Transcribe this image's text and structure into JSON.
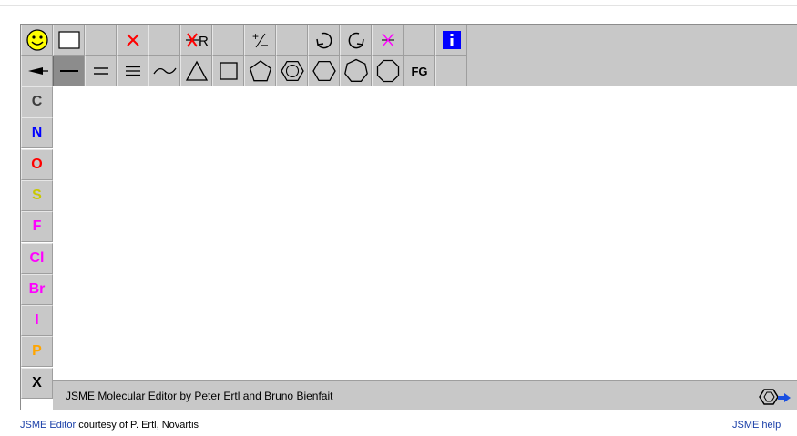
{
  "app": {
    "status_text": "JSME Molecular Editor by Peter Ertl and Bruno Bienfait"
  },
  "toolbar_top": [
    {
      "name": "smiley-icon",
      "kind": "icon"
    },
    {
      "name": "clear-icon",
      "kind": "icon"
    },
    {
      "name": "empty",
      "kind": "empty"
    },
    {
      "name": "delete-icon",
      "kind": "icon"
    },
    {
      "name": "empty",
      "kind": "empty"
    },
    {
      "name": "delete-r-icon",
      "kind": "icon"
    },
    {
      "name": "empty",
      "kind": "empty"
    },
    {
      "name": "charge-icon",
      "kind": "icon"
    },
    {
      "name": "empty",
      "kind": "empty"
    },
    {
      "name": "undo-icon",
      "kind": "icon"
    },
    {
      "name": "redo-icon",
      "kind": "icon"
    },
    {
      "name": "reaction-icon",
      "kind": "icon"
    },
    {
      "name": "empty",
      "kind": "empty"
    },
    {
      "name": "info-icon",
      "kind": "icon"
    }
  ],
  "toolbar_bottom": [
    {
      "name": "bond-stereo-icon",
      "kind": "icon"
    },
    {
      "name": "single-bond-icon",
      "kind": "icon",
      "selected": true
    },
    {
      "name": "double-bond-icon",
      "kind": "icon"
    },
    {
      "name": "triple-bond-icon",
      "kind": "icon"
    },
    {
      "name": "chain-icon",
      "kind": "icon"
    },
    {
      "name": "ring3-icon",
      "kind": "icon"
    },
    {
      "name": "ring4-icon",
      "kind": "icon"
    },
    {
      "name": "ring5-icon",
      "kind": "icon"
    },
    {
      "name": "benzene-icon",
      "kind": "icon"
    },
    {
      "name": "ring6-icon",
      "kind": "icon"
    },
    {
      "name": "ring7-icon",
      "kind": "icon"
    },
    {
      "name": "ring8-icon",
      "kind": "icon"
    },
    {
      "name": "fg-button",
      "kind": "text",
      "label": "FG"
    },
    {
      "name": "empty",
      "kind": "empty"
    }
  ],
  "atoms": [
    {
      "symbol": "C",
      "color": "#3c3c3c"
    },
    {
      "symbol": "N",
      "color": "#0000ff"
    },
    {
      "symbol": "O",
      "color": "#ff0000"
    },
    {
      "symbol": "S",
      "color": "#c8c800"
    },
    {
      "symbol": "F",
      "color": "#ff00ff"
    },
    {
      "symbol": "Cl",
      "color": "#ff00ff"
    },
    {
      "symbol": "Br",
      "color": "#ff00ff"
    },
    {
      "symbol": "I",
      "color": "#ff00ff"
    },
    {
      "symbol": "P",
      "color": "#ffa500"
    },
    {
      "symbol": "X",
      "color": "#000000"
    }
  ],
  "footer": {
    "left_link": "JSME Editor",
    "left_text": " courtesy of P. Ertl, Novartis",
    "right_link": "JSME help"
  }
}
